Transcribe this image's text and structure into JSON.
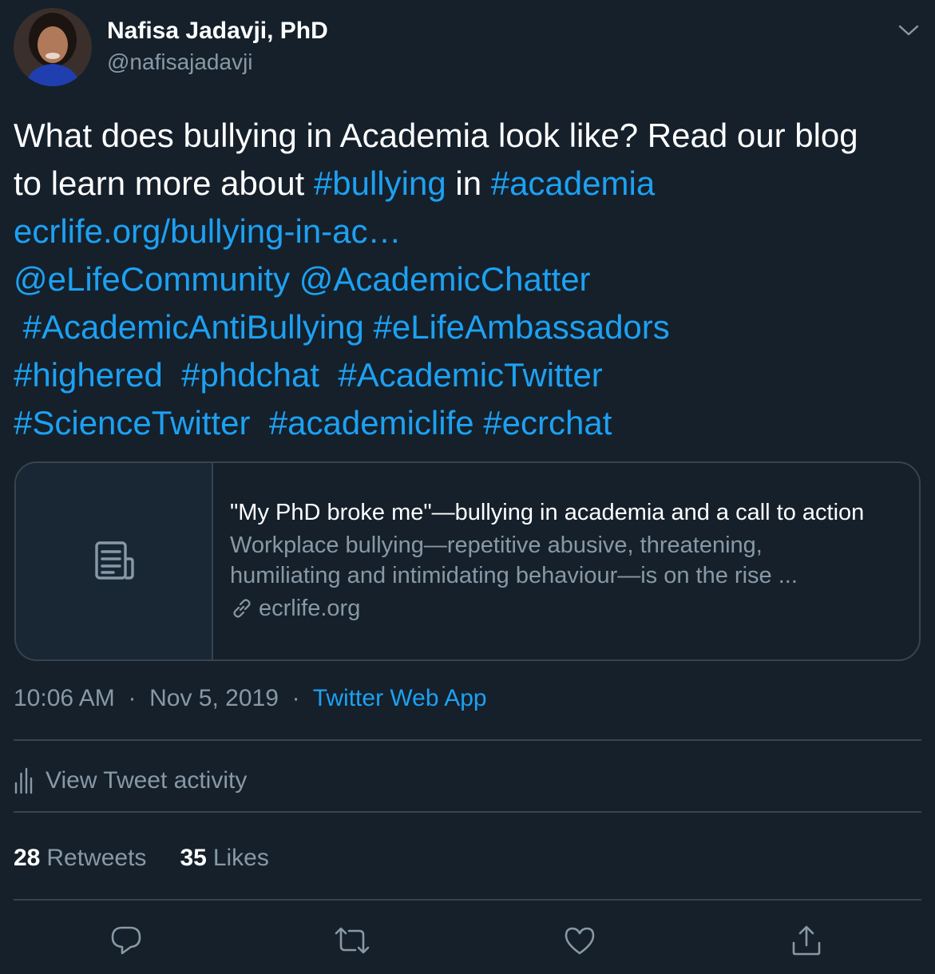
{
  "author": {
    "display_name": "Nafisa Jadavji, PhD",
    "handle": "@nafisajadavji"
  },
  "tweet": {
    "lines": [
      [
        {
          "t": "What does bullying in Academia look like? Read our blog",
          "link": false
        }
      ],
      [
        {
          "t": "to learn more about ",
          "link": false
        },
        {
          "t": "#bullying",
          "link": true
        },
        {
          "t": " in ",
          "link": false
        },
        {
          "t": "#academia",
          "link": true
        }
      ],
      [
        {
          "t": "ecrlife.org/bullying-in-ac…",
          "link": true
        }
      ],
      [
        {
          "t": "@eLifeCommunity",
          "link": true
        },
        {
          "t": " ",
          "link": false
        },
        {
          "t": "@AcademicChatter",
          "link": true
        }
      ],
      [
        {
          "t": " ",
          "link": false
        },
        {
          "t": "#AcademicAntiBullying",
          "link": true
        },
        {
          "t": " ",
          "link": false
        },
        {
          "t": "#eLifeAmbassadors",
          "link": true
        }
      ],
      [
        {
          "t": "#highered",
          "link": true
        },
        {
          "t": "  ",
          "link": false
        },
        {
          "t": "#phdchat",
          "link": true
        },
        {
          "t": "  ",
          "link": false
        },
        {
          "t": "#AcademicTwitter",
          "link": true
        }
      ],
      [
        {
          "t": "#ScienceTwitter",
          "link": true
        },
        {
          "t": "  ",
          "link": false
        },
        {
          "t": "#academiclife",
          "link": true
        },
        {
          "t": " ",
          "link": false
        },
        {
          "t": "#ecrchat",
          "link": true
        }
      ]
    ]
  },
  "card": {
    "title": "\"My PhD broke me\"—bullying in academia and a call to action",
    "description_lines": [
      "Workplace bullying—repetitive abusive, threatening,",
      "humiliating and intimidating behaviour—is on the rise ..."
    ],
    "domain": "ecrlife.org"
  },
  "meta": {
    "time": "10:06 AM",
    "date": "Nov 5, 2019",
    "separator": "·",
    "source": "Twitter Web App"
  },
  "activity": {
    "label": "View Tweet activity"
  },
  "stats": {
    "retweets_count": "28",
    "retweets_label": "Retweets",
    "likes_count": "35",
    "likes_label": "Likes"
  },
  "icons": {
    "caret": "chevron-down-icon",
    "reply": "reply-icon",
    "retweet": "retweet-icon",
    "like": "heart-icon",
    "share": "share-icon",
    "activity": "bar-chart-icon",
    "link": "link-icon",
    "card_thumb": "article-icon"
  },
  "colors": {
    "background": "#15202b",
    "accent": "#1da1f2",
    "secondary_text": "#8899a6",
    "border": "#38444d"
  }
}
